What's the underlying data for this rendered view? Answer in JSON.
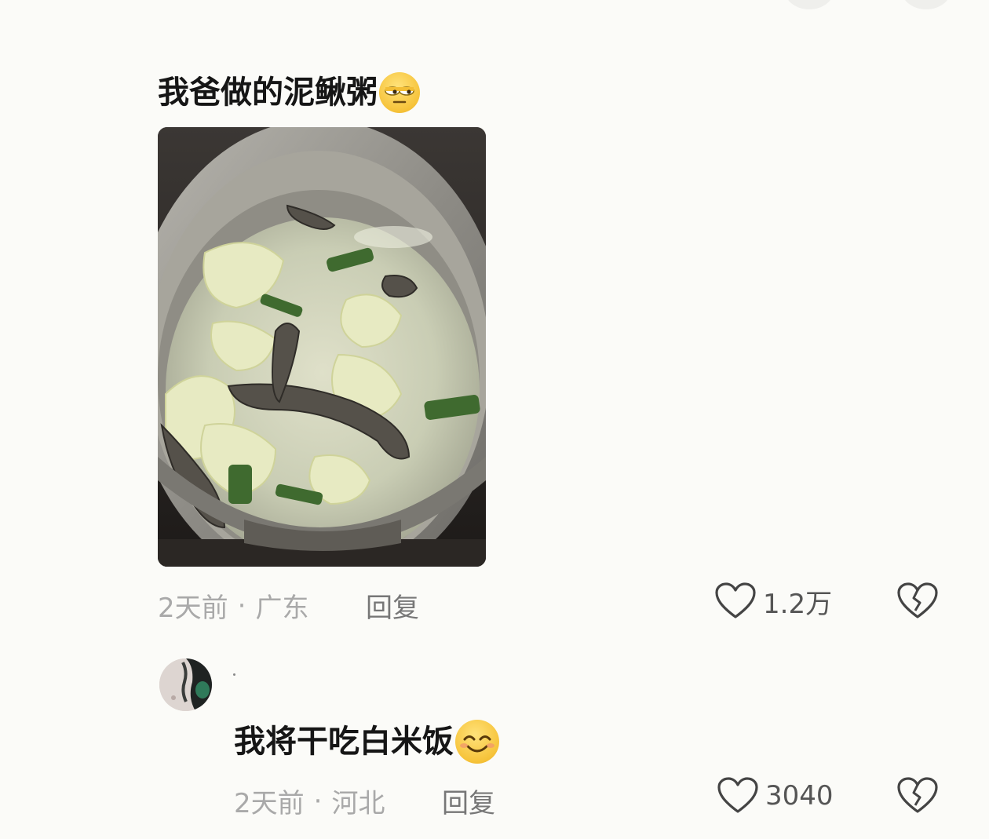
{
  "comment": {
    "text": "我爸做的泥鳅粥",
    "emoji_icon": "rolling-eyes-emoji",
    "time": "2天前",
    "separator": "·",
    "location": "广东",
    "reply_label": "回复",
    "like_count": "1.2万"
  },
  "reply": {
    "text": "我将干吃白米饭",
    "emoji_icon": "smiling-emoji",
    "time": "2天前",
    "separator": "·",
    "location": "河北",
    "reply_label": "回复",
    "like_count": "3040"
  },
  "icons": {
    "like": "heart-outline-icon",
    "dislike": "broken-heart-icon"
  },
  "colors": {
    "background": "#fbfbf8",
    "text_primary": "#161616",
    "text_meta": "#a9a9a9",
    "emoji_yellow": "#f6c33a"
  }
}
